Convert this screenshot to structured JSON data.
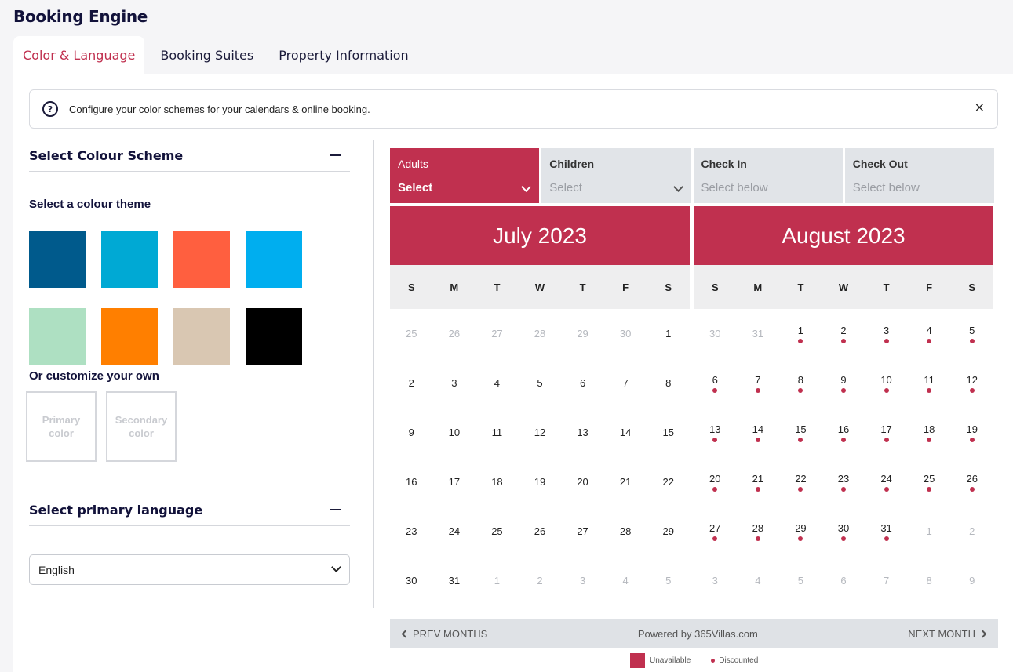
{
  "page": {
    "title": "Booking Engine"
  },
  "tabs": [
    {
      "label": "Color & Language",
      "active": true
    },
    {
      "label": "Booking Suites",
      "active": false
    },
    {
      "label": "Property Information",
      "active": false
    }
  ],
  "info": {
    "text": "Configure your color schemes for your calendars & online booking.",
    "icon": "question-bubble-icon",
    "close": "×"
  },
  "colour_scheme": {
    "title": "Select Colour Scheme",
    "theme_label": "Select a colour theme",
    "swatches": [
      "#005a8c",
      "#00a9d4",
      "#ff5f3f",
      "#00aeef",
      "#aee0c2",
      "#ff7f00",
      "#d9c7b2",
      "#000000"
    ],
    "custom_label": "Or customize your own",
    "primary_label": "Primary color",
    "secondary_label": "Secondary color"
  },
  "language": {
    "title": "Select primary language",
    "value": "English"
  },
  "booking": {
    "fields": [
      {
        "label": "Adults",
        "value": "Select",
        "has_dropdown": true
      },
      {
        "label": "Children",
        "value": "Select",
        "has_dropdown": true
      },
      {
        "label": "Check In",
        "value": "Select below",
        "has_dropdown": false
      },
      {
        "label": "Check Out",
        "value": "Select below",
        "has_dropdown": false
      }
    ],
    "days_of_week": [
      "S",
      "M",
      "T",
      "W",
      "T",
      "F",
      "S"
    ],
    "months": [
      {
        "title": "July 2023",
        "days": [
          {
            "d": "25",
            "m": true
          },
          {
            "d": "26",
            "m": true
          },
          {
            "d": "27",
            "m": true
          },
          {
            "d": "28",
            "m": true
          },
          {
            "d": "29",
            "m": true
          },
          {
            "d": "30",
            "m": true
          },
          {
            "d": "1"
          },
          {
            "d": "2"
          },
          {
            "d": "3"
          },
          {
            "d": "4"
          },
          {
            "d": "5"
          },
          {
            "d": "6"
          },
          {
            "d": "7"
          },
          {
            "d": "8"
          },
          {
            "d": "9"
          },
          {
            "d": "10"
          },
          {
            "d": "11"
          },
          {
            "d": "12"
          },
          {
            "d": "13"
          },
          {
            "d": "14"
          },
          {
            "d": "15"
          },
          {
            "d": "16"
          },
          {
            "d": "17"
          },
          {
            "d": "18"
          },
          {
            "d": "19"
          },
          {
            "d": "20"
          },
          {
            "d": "21"
          },
          {
            "d": "22"
          },
          {
            "d": "23"
          },
          {
            "d": "24"
          },
          {
            "d": "25"
          },
          {
            "d": "26"
          },
          {
            "d": "27"
          },
          {
            "d": "28"
          },
          {
            "d": "29"
          },
          {
            "d": "30"
          },
          {
            "d": "31"
          },
          {
            "d": "1",
            "m": true
          },
          {
            "d": "2",
            "m": true
          },
          {
            "d": "3",
            "m": true
          },
          {
            "d": "4",
            "m": true
          },
          {
            "d": "5",
            "m": true
          }
        ]
      },
      {
        "title": "August 2023",
        "days": [
          {
            "d": "30",
            "m": true
          },
          {
            "d": "31",
            "m": true
          },
          {
            "d": "1",
            "dot": true
          },
          {
            "d": "2",
            "dot": true
          },
          {
            "d": "3",
            "dot": true
          },
          {
            "d": "4",
            "dot": true
          },
          {
            "d": "5",
            "dot": true
          },
          {
            "d": "6",
            "dot": true
          },
          {
            "d": "7",
            "dot": true
          },
          {
            "d": "8",
            "dot": true
          },
          {
            "d": "9",
            "dot": true
          },
          {
            "d": "10",
            "dot": true
          },
          {
            "d": "11",
            "dot": true
          },
          {
            "d": "12",
            "dot": true
          },
          {
            "d": "13",
            "dot": true
          },
          {
            "d": "14",
            "dot": true
          },
          {
            "d": "15",
            "dot": true
          },
          {
            "d": "16",
            "dot": true
          },
          {
            "d": "17",
            "dot": true
          },
          {
            "d": "18",
            "dot": true
          },
          {
            "d": "19",
            "dot": true
          },
          {
            "d": "20",
            "dot": true
          },
          {
            "d": "21",
            "dot": true
          },
          {
            "d": "22",
            "dot": true
          },
          {
            "d": "23",
            "dot": true
          },
          {
            "d": "24",
            "dot": true
          },
          {
            "d": "25",
            "dot": true
          },
          {
            "d": "26",
            "dot": true
          },
          {
            "d": "27",
            "dot": true
          },
          {
            "d": "28",
            "dot": true
          },
          {
            "d": "29",
            "dot": true
          },
          {
            "d": "30",
            "dot": true
          },
          {
            "d": "31",
            "dot": true
          },
          {
            "d": "1",
            "m": true
          },
          {
            "d": "2",
            "m": true
          },
          {
            "d": "3",
            "m": true
          },
          {
            "d": "4",
            "m": true
          },
          {
            "d": "5",
            "m": true
          },
          {
            "d": "6",
            "m": true
          },
          {
            "d": "7",
            "m": true
          },
          {
            "d": "8",
            "m": true
          },
          {
            "d": "9",
            "m": true
          }
        ]
      }
    ],
    "footer": {
      "prev": "PREV MONTHS",
      "powered": "Powered by 365Villas.com",
      "next": "NEXT MONTH"
    },
    "legend": {
      "unavailable": "Unavailable",
      "discounted": "Discounted"
    }
  },
  "colors": {
    "accent": "#c0304f",
    "field_bg": "#e1e4e8"
  }
}
